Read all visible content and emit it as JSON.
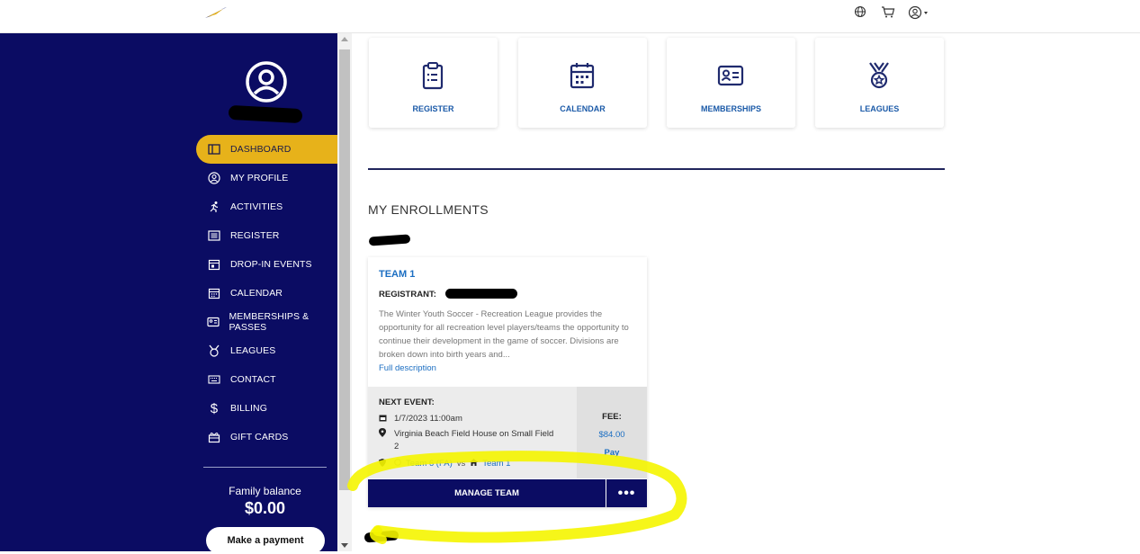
{
  "header": {
    "logo_icon": "wing-logo-icon",
    "icons": [
      "globe-icon",
      "cart-icon",
      "user-circle-icon",
      "caret-down-icon"
    ]
  },
  "sidebar": {
    "items": [
      {
        "label": "DASHBOARD",
        "icon": "layout-icon",
        "active": true
      },
      {
        "label": "MY PROFILE",
        "icon": "user-circle-icon"
      },
      {
        "label": "ACTIVITIES",
        "icon": "runner-icon"
      },
      {
        "label": "REGISTER",
        "icon": "list-icon"
      },
      {
        "label": "DROP-IN EVENTS",
        "icon": "calendar-event-icon"
      },
      {
        "label": "CALENDAR",
        "icon": "calendar-icon"
      },
      {
        "label": "MEMBERSHIPS & PASSES",
        "icon": "id-card-icon"
      },
      {
        "label": "LEAGUES",
        "icon": "medal-icon"
      },
      {
        "label": "CONTACT",
        "icon": "keyboard-icon"
      },
      {
        "label": "BILLING",
        "icon": "dollar-icon"
      },
      {
        "label": "GIFT CARDS",
        "icon": "gift-icon"
      }
    ],
    "balance_label": "Family balance",
    "balance_value": "$0.00",
    "payment_button": "Make a payment"
  },
  "tiles": [
    {
      "label": "REGISTER",
      "icon": "clipboard-icon"
    },
    {
      "label": "CALENDAR",
      "icon": "calendar-icon"
    },
    {
      "label": "MEMBERSHIPS",
      "icon": "id-card-icon"
    },
    {
      "label": "LEAGUES",
      "icon": "medal-icon"
    }
  ],
  "enrollments": {
    "title": "MY ENROLLMENTS",
    "card": {
      "team_name": "TEAM 1",
      "registrant_label": "REGISTRANT:",
      "description": "The Winter Youth Soccer - Recreation League provides the opportunity for all recreation level players/teams the opportunity to continue their development in the game of soccer. Divisions are broken down into birth years and...",
      "full_description_link": "Full description",
      "next_event_label": "NEXT EVENT:",
      "event_date": "1/7/2023 11:00am",
      "event_location_line1": "Virginia Beach Field House on Small Field",
      "event_location_line2": "2",
      "matchup_away": "Team 6 (FA)",
      "matchup_vs": "vs",
      "matchup_home": "Team 1",
      "fee_label": "FEE:",
      "fee_value": "$84.00",
      "fee_pay": "Pay",
      "manage_button": "MANAGE TEAM",
      "more_button": "•••"
    }
  },
  "colors": {
    "sidebar_bg": "#0b0c63",
    "active_bg": "#e7b21a",
    "link": "#1b6ec2",
    "highlight": "#f5f500"
  }
}
